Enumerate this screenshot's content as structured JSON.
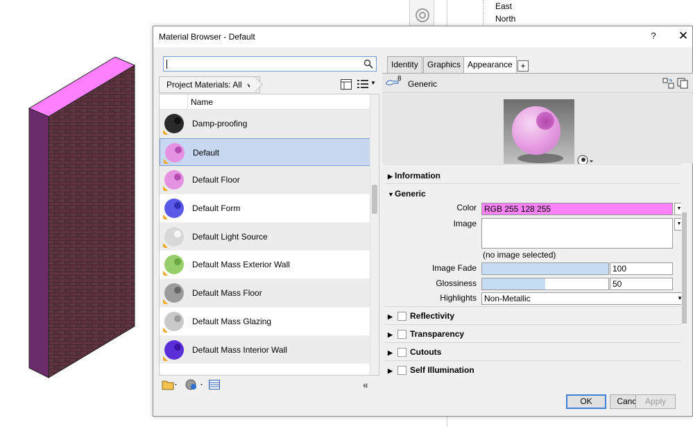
{
  "background": {
    "tree_items": [
      "East",
      "North"
    ]
  },
  "dialog": {
    "title": "Material Browser - Default",
    "help_label": "?",
    "close_label": "✕"
  },
  "left": {
    "search": {
      "value": "",
      "placeholder": ""
    },
    "filter_label": "Project Materials: All",
    "column_header": "Name",
    "materials": [
      {
        "name": "Damp-proofing",
        "ball": "#2a2a2a",
        "hole": "#111111"
      },
      {
        "name": "Default",
        "ball": "#e692e2",
        "hole": "#b54db0",
        "selected": true
      },
      {
        "name": "Default Floor",
        "ball": "#e692e2",
        "hole": "#b54db0"
      },
      {
        "name": "Default Form",
        "ball": "#5a5ae8",
        "hole": "#3030b8"
      },
      {
        "name": "Default Light Source",
        "ball": "#d8d8d8",
        "hole": "#f5f5f5"
      },
      {
        "name": "Default Mass Exterior Wall",
        "ball": "#96cf6a",
        "hole": "#6aa544"
      },
      {
        "name": "Default Mass Floor",
        "ball": "#9b9b9b",
        "hole": "#666666"
      },
      {
        "name": "Default Mass Glazing",
        "ball": "#c9c9c9",
        "hole": "#9a9a9a"
      },
      {
        "name": "Default Mass Interior Wall",
        "ball": "#5b2fd8",
        "hole": "#3a14a8"
      }
    ]
  },
  "right": {
    "tabs": [
      "Identity",
      "Graphics",
      "Appearance"
    ],
    "active_tab": "Appearance",
    "add_tab_label": "+",
    "asset": {
      "count": "8",
      "name": "Generic"
    },
    "sections": {
      "information": "Information",
      "generic": "Generic",
      "reflectivity": "Reflectivity",
      "transparency": "Transparency",
      "cutouts": "Cutouts",
      "self_illumination": "Self Illumination"
    },
    "fields": {
      "color_label": "Color",
      "color_value": "RGB 255 128 255",
      "image_label": "Image",
      "no_image": "(no image selected)",
      "image_fade_label": "Image Fade",
      "image_fade_value": "100",
      "image_fade_fraction": 1.0,
      "glossiness_label": "Glossiness",
      "glossiness_value": "50",
      "glossiness_fraction": 0.5,
      "highlights_label": "Highlights",
      "highlights_value": "Non-Metallic"
    }
  },
  "buttons": {
    "ok": "OK",
    "cancel": "Cancel",
    "apply": "Apply"
  },
  "colors": {
    "swatch": "#ff80ff",
    "accent": "#3c7fd6",
    "selection": "#c7d8f0"
  }
}
